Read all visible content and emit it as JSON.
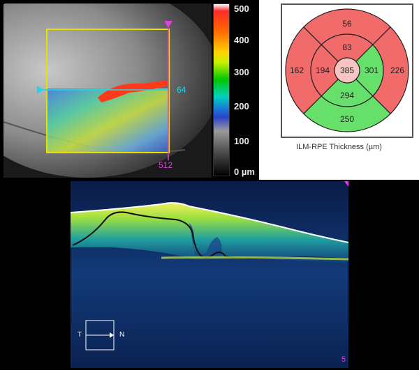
{
  "fundus": {
    "scan_top_label": "64",
    "scan_bottom_label": "512"
  },
  "color_scale": {
    "ticks": [
      "500",
      "400",
      "300",
      "200",
      "100",
      "0 µm"
    ]
  },
  "thickness_map": {
    "caption": "ILM-RPE Thickness (µm)",
    "center": "385",
    "inner_superior": "83",
    "inner_nasal": "301",
    "inner_inferior": "294",
    "inner_temporal": "194",
    "outer_superior": "56",
    "outer_nasal": "226",
    "outer_inferior": "250",
    "outer_temporal": "162",
    "colors": {
      "thick": "#f26b6b",
      "normal": "#66e06a",
      "center": "#f7c4c4",
      "line": "#222222"
    }
  },
  "bscan": {
    "orientation_left": "T",
    "orientation_right": "N",
    "corner_label": "5"
  }
}
